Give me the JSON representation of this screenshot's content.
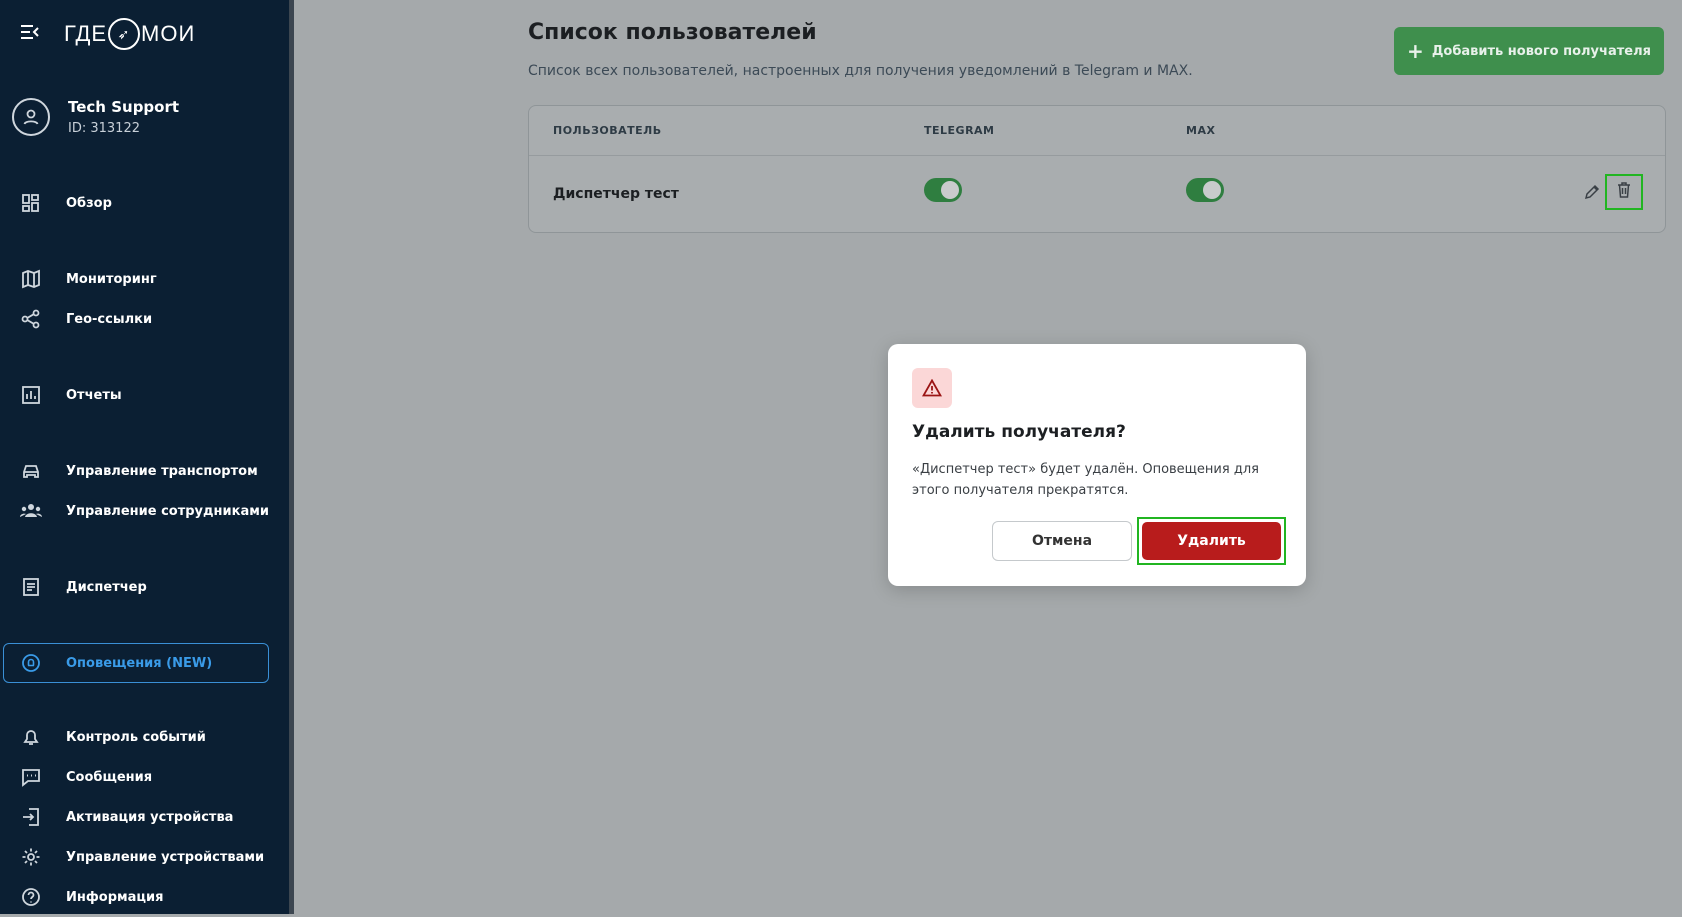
{
  "sidebar": {
    "logo_left": "ГДЕ",
    "logo_right": "МОИ",
    "user_name": "Tech Support",
    "user_id": "ID: 313122",
    "items": [
      {
        "label": "Обзор",
        "icon": "dashboard-icon"
      },
      {
        "label": "Мониторинг",
        "icon": "map-icon"
      },
      {
        "label": "Гео-ссылки",
        "icon": "share-icon"
      },
      {
        "label": "Отчеты",
        "icon": "report-icon"
      },
      {
        "label": "Управление транспортом",
        "icon": "car-icon"
      },
      {
        "label": "Управление сотрудниками",
        "icon": "people-icon"
      },
      {
        "label": "Диспетчер",
        "icon": "document-icon"
      },
      {
        "label": "Оповещения (NEW)",
        "icon": "alert-circle-icon"
      },
      {
        "label": "Контроль событий",
        "icon": "bell-icon"
      },
      {
        "label": "Сообщения",
        "icon": "chat-icon"
      },
      {
        "label": "Активация устройства",
        "icon": "login-icon"
      },
      {
        "label": "Управление устройствами",
        "icon": "gear-icon"
      },
      {
        "label": "Информация",
        "icon": "help-icon"
      }
    ]
  },
  "main": {
    "title": "Список пользователей",
    "subtitle": "Список всех пользователей, настроенных для получения уведомлений в Telegram и MAX.",
    "add_button": "Добавить нового получателя",
    "table": {
      "headers": [
        "ПОЛЬЗОВАТЕЛЬ",
        "TELEGRAM",
        "MAX"
      ],
      "rows": [
        {
          "name": "Диспетчер тест",
          "telegram": true,
          "max": true
        }
      ]
    }
  },
  "modal": {
    "title": "Удалить получателя?",
    "text": "«Диспетчер тест» будет удалён. Оповещения для этого получателя прекратятся.",
    "cancel": "Отмена",
    "confirm": "Удалить"
  },
  "colors": {
    "sidebar_bg": "#0b1f33",
    "accent_green": "#3f8f4d",
    "danger_red": "#b81c1c",
    "active_blue": "#3a9be8"
  }
}
